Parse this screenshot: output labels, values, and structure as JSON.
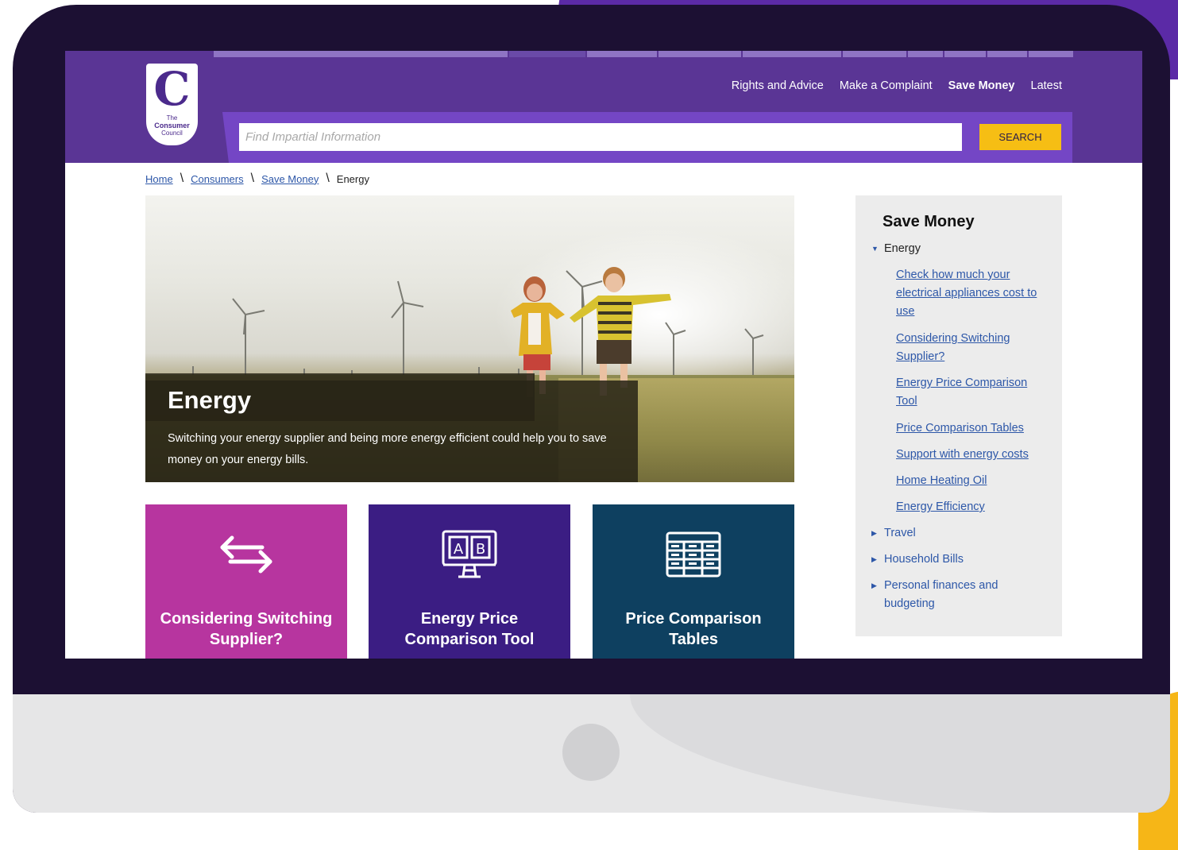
{
  "header": {
    "logo_text": [
      "The",
      "Consumer",
      "Council"
    ],
    "nav": [
      {
        "label": "Rights and Advice",
        "active": false
      },
      {
        "label": "Make a Complaint",
        "active": false
      },
      {
        "label": "Save Money",
        "active": true
      },
      {
        "label": "Latest",
        "active": false
      }
    ],
    "search": {
      "placeholder": "Find Impartial Information",
      "value": "",
      "button_label": "SEARCH"
    }
  },
  "breadcrumb": [
    {
      "label": "Home",
      "link": true
    },
    {
      "label": "Consumers",
      "link": true
    },
    {
      "label": "Save Money",
      "link": true
    },
    {
      "label": "Energy",
      "link": false
    }
  ],
  "hero": {
    "title": "Energy",
    "description": "Switching your energy supplier and being more energy efficient could help you to save money on your energy bills."
  },
  "tiles": [
    {
      "label": "Considering Switching Supplier?",
      "icon": "arrows-swap-icon",
      "color": "#b7359f"
    },
    {
      "label": "Energy Price Comparison Tool",
      "icon": "ab-comparison-icon",
      "color": "#3b1d83"
    },
    {
      "label": "Price Comparison Tables",
      "icon": "table-icon",
      "color": "#0e4060"
    }
  ],
  "sidebar": {
    "title": "Save Money",
    "sections": [
      {
        "label": "Energy",
        "expanded": true,
        "links": [
          "Check how much your electrical appliances cost to use",
          "Considering Switching Supplier?",
          "Energy Price Comparison Tool",
          "Price Comparison Tables",
          "Support with energy costs",
          "Home Heating Oil",
          "Energy Efficiency"
        ]
      },
      {
        "label": "Travel",
        "expanded": false
      },
      {
        "label": "Household Bills",
        "expanded": false
      },
      {
        "label": "Personal finances and budgeting",
        "expanded": false
      }
    ]
  },
  "colors": {
    "header_purple": "#5a3595",
    "search_band": "#7446c5",
    "search_button": "#f6be14",
    "link_blue": "#2d57a8"
  }
}
